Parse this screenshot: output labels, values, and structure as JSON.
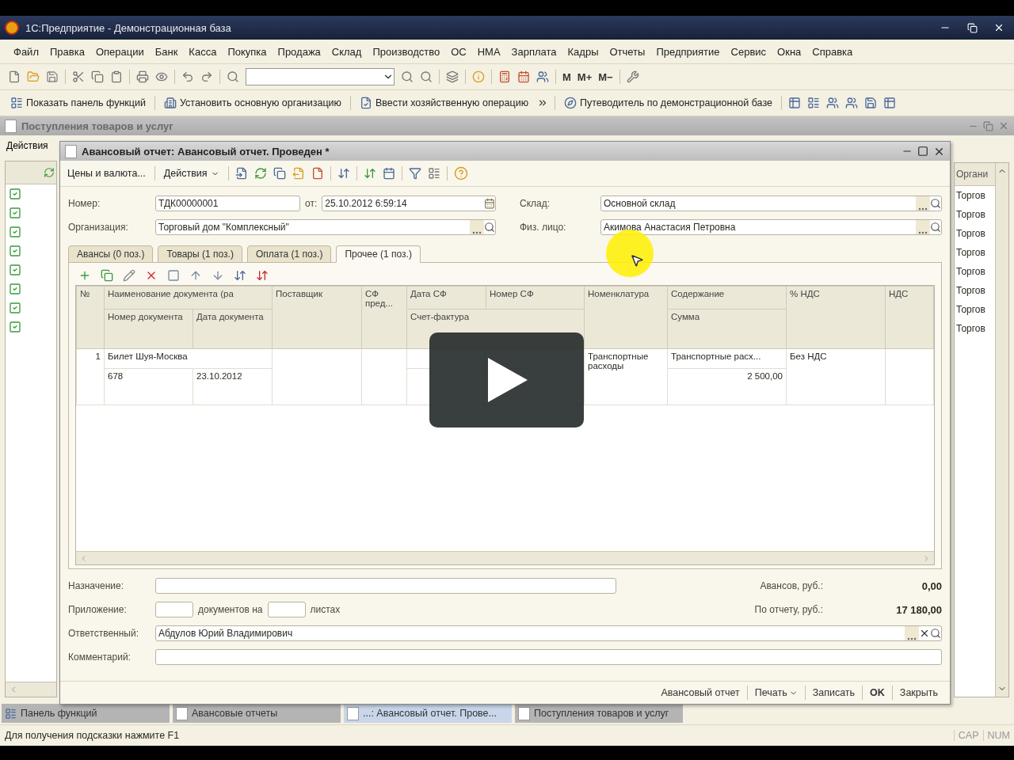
{
  "app": {
    "title": "1С:Предприятие - Демонстрационная база"
  },
  "menu": [
    "Файл",
    "Правка",
    "Операции",
    "Банк",
    "Касса",
    "Покупка",
    "Продажа",
    "Склад",
    "Производство",
    "ОС",
    "НМА",
    "Зарплата",
    "Кадры",
    "Отчеты",
    "Предприятие",
    "Сервис",
    "Окна",
    "Справка"
  ],
  "memory_buttons": [
    "M",
    "M+",
    "M−"
  ],
  "function_bar": [
    "Показать панель функций",
    "Установить основную организацию",
    "Ввести хозяйственную операцию",
    "Путеводитель по демонстрационной базе"
  ],
  "list_window": {
    "title": "Поступления товаров и услуг",
    "actions": "Действия",
    "column_header": "Органи",
    "rows": [
      "Торгов",
      "Торгов",
      "Торгов",
      "Торгов",
      "Торгов",
      "Торгов",
      "Торгов",
      "Торгов"
    ]
  },
  "document": {
    "title": "Авансовый отчет: Авансовый отчет. Проведен *",
    "toolbar": [
      "Цены и валюта...",
      "Действия"
    ],
    "number": {
      "label": "Номер:",
      "value": "ТДК00000001"
    },
    "date": {
      "label": "от:",
      "value": "25.10.2012  6:59:14"
    },
    "organization": {
      "label": "Организация:",
      "value": "Торговый дом \"Комплексный\""
    },
    "warehouse": {
      "label": "Склад:",
      "value": "Основной склад"
    },
    "person": {
      "label": "Физ. лицо:",
      "value": "Акимова Анастасия Петровна"
    },
    "tabs": [
      {
        "label": "Авансы (0 поз.)",
        "selected": false
      },
      {
        "label": "Товары (1 поз.)",
        "selected": false
      },
      {
        "label": "Оплата (1 поз.)",
        "selected": false
      },
      {
        "label": "Прочее (1 поз.)",
        "selected": true
      }
    ],
    "columns": {
      "no": "№",
      "doc_name": "Наименование документа (ра",
      "doc_number": "Номер документа",
      "doc_date": "Дата документа",
      "supplier": "Поставщик",
      "invoice_flag": "СФ пред...",
      "invoice_date": "Дата СФ",
      "invoice_number": "Номер СФ",
      "invoice": "Счет-фактура",
      "item": "Номенклатура",
      "content": "Содержание",
      "amount": "Сумма",
      "vat_rate": "% НДС",
      "vat": "НДС"
    },
    "rows": [
      {
        "no": "1",
        "doc_name": "Билет Шуя-Москва",
        "doc_number": "678",
        "doc_date": "23.10.2012",
        "item": "Транспортные расходы",
        "content": "Транспортные расх...",
        "amount": "2 500,00",
        "vat_rate": "Без НДС"
      }
    ],
    "purpose": {
      "label": "Назначение:"
    },
    "attachment": {
      "label": "Приложение:",
      "middle": "документов на",
      "end": "листах"
    },
    "responsible": {
      "label": "Ответственный:",
      "value": "Абдулов Юрий Владимирович"
    },
    "comment": {
      "label": "Комментарий:"
    },
    "totals": [
      {
        "label": "Авансов, руб.:",
        "value": "0,00"
      },
      {
        "label": "По отчету, руб.:",
        "value": "17 180,00"
      }
    ],
    "footer_buttons": [
      {
        "label": "Авансовый отчет",
        "kind": "plain"
      },
      {
        "label": "Печать",
        "kind": "menu"
      },
      {
        "label": "Записать",
        "kind": "plain"
      },
      {
        "label": "OK",
        "kind": "default"
      },
      {
        "label": "Закрыть",
        "kind": "plain"
      }
    ]
  },
  "taskbar": [
    {
      "label": "Панель функций",
      "selected": false,
      "kind": "panel"
    },
    {
      "label": "Авансовые отчеты",
      "selected": false,
      "kind": "document"
    },
    {
      "label": "...: Авансовый отчет. Прове...",
      "selected": true,
      "kind": "document"
    },
    {
      "label": "Поступления товаров и услуг",
      "selected": false,
      "kind": "document"
    }
  ],
  "status_bar": {
    "hint": "Для получения подсказки нажмите F1",
    "indicators": [
      "CAP",
      "NUM"
    ]
  }
}
